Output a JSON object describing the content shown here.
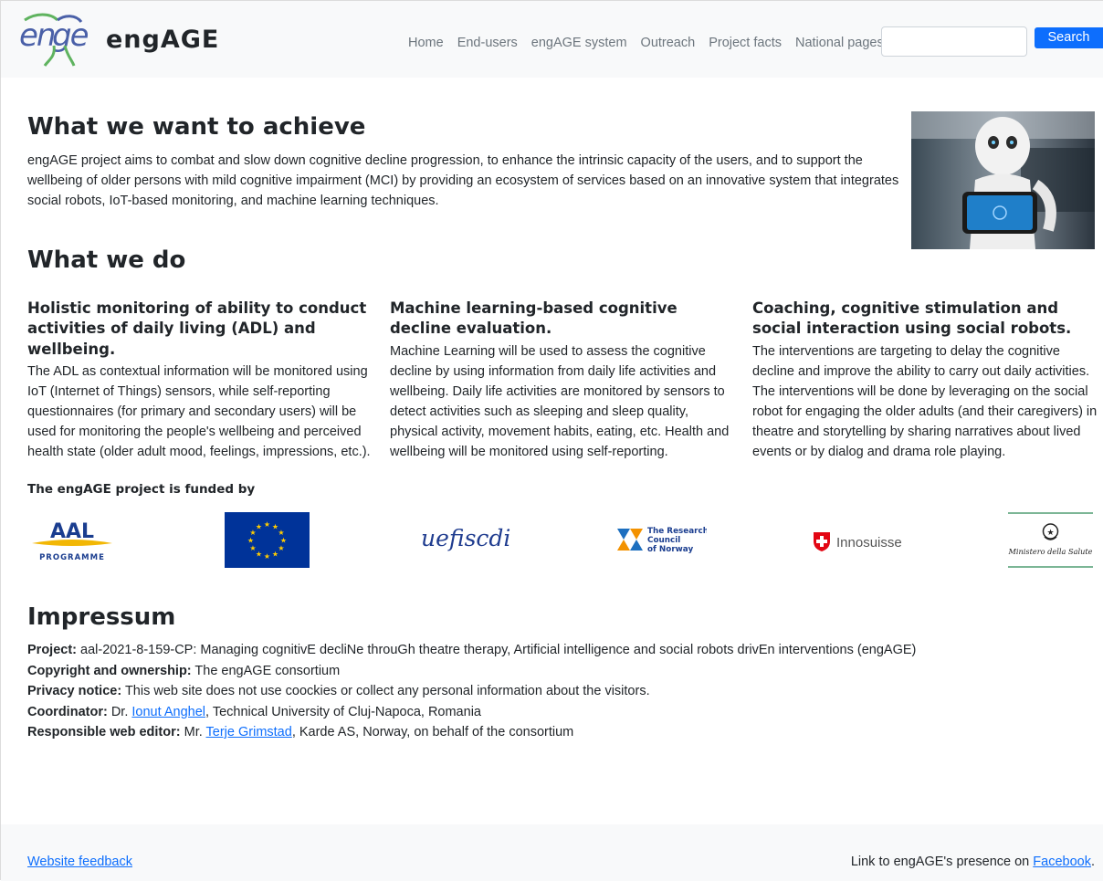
{
  "header": {
    "brand_name": "engAGE",
    "nav": [
      "Home",
      "End-users",
      "engAGE system",
      "Outreach",
      "Project facts",
      "National pages"
    ],
    "search_placeholder": "",
    "search_button": "Search"
  },
  "achieve": {
    "title": "What we want to achieve",
    "body": "engAGE project aims to combat and slow down cognitive decline progression, to enhance the intrinsic capacity of the users, and to support the wellbeing of older persons with mild cognitive impairment (MCI) by providing an ecosystem of services based on an innovative system that integrates social robots, IoT-based monitoring, and machine learning techniques."
  },
  "whatwedo": {
    "title": "What we do",
    "columns": [
      {
        "heading": "Holistic monitoring of ability to conduct activities of daily living (ADL) and wellbeing.",
        "body": "The ADL as contextual information will be monitored using IoT (Internet of Things) sensors, while self-reporting questionnaires (for primary and secondary users) will be used for monitoring the people's wellbeing and perceived health state (older adult mood, feelings, impressions, etc.)."
      },
      {
        "heading": "Machine learning-based cognitive decline evaluation.",
        "body": "Machine Learning will be used to assess the cognitive decline by using information from daily life activities and wellbeing. Daily life activities are monitored by sensors to detect activities such as sleeping and sleep quality, physical activity, movement habits, eating, etc. Health and wellbeing will be monitored using self-reporting."
      },
      {
        "heading": "Coaching, cognitive stimulation and social interaction using social robots.",
        "body": "The interventions are targeting to delay the cognitive decline and improve the ability to carry out daily activities. The interventions will be done by leveraging on the social robot for engaging the older adults (and their caregivers) in theatre and storytelling by sharing narratives about lived events or by dialog and drama role playing."
      }
    ]
  },
  "funders": {
    "title": "The engAGE project is funded by",
    "aal_word": "AAL",
    "aal_sub": "PROGRAMME",
    "uefiscdi": "uefiscdi",
    "rcn_lines": [
      "The Research",
      "Council",
      "of Norway"
    ],
    "innosuisse": "Innosuisse",
    "ministero": "Ministero della Salute"
  },
  "impressum": {
    "title": "Impressum",
    "project_label": "Project:",
    "project_value": " aal-2021-8-159-CP: Managing cognitivE decliNe throuGh theatre therapy, Artificial intelligence and social robots drivEn interventions (engAGE)",
    "copyright_label": "Copyright and ownership:",
    "copyright_value": " The engAGE consortium",
    "privacy_label": "Privacy notice:",
    "privacy_value": " This web site does not use coockies or collect any personal information about the visitors.",
    "coordinator_label": "Coordinator:",
    "coordinator_prefix": " Dr. ",
    "coordinator_link": "Ionut Anghel",
    "coordinator_suffix": ", Technical University of Cluj-Napoca, Romania",
    "editor_label": "Responsible web editor:",
    "editor_prefix": " Mr. ",
    "editor_link": "Terje Grimstad",
    "editor_suffix": ", Karde AS, Norway, on behalf of the consortium"
  },
  "footer": {
    "feedback_link": "Website feedback",
    "facebook_prefix": "Link to engAGE's presence on ",
    "facebook_link": "Facebook",
    "facebook_suffix": "."
  },
  "colors": {
    "primary": "#0d6efd",
    "nav_bg": "#f8f9fa",
    "text": "#212529",
    "muted": "#6c757d",
    "eu_blue": "#003399",
    "eu_gold": "#ffcc00",
    "swiss_red": "#e30613"
  }
}
